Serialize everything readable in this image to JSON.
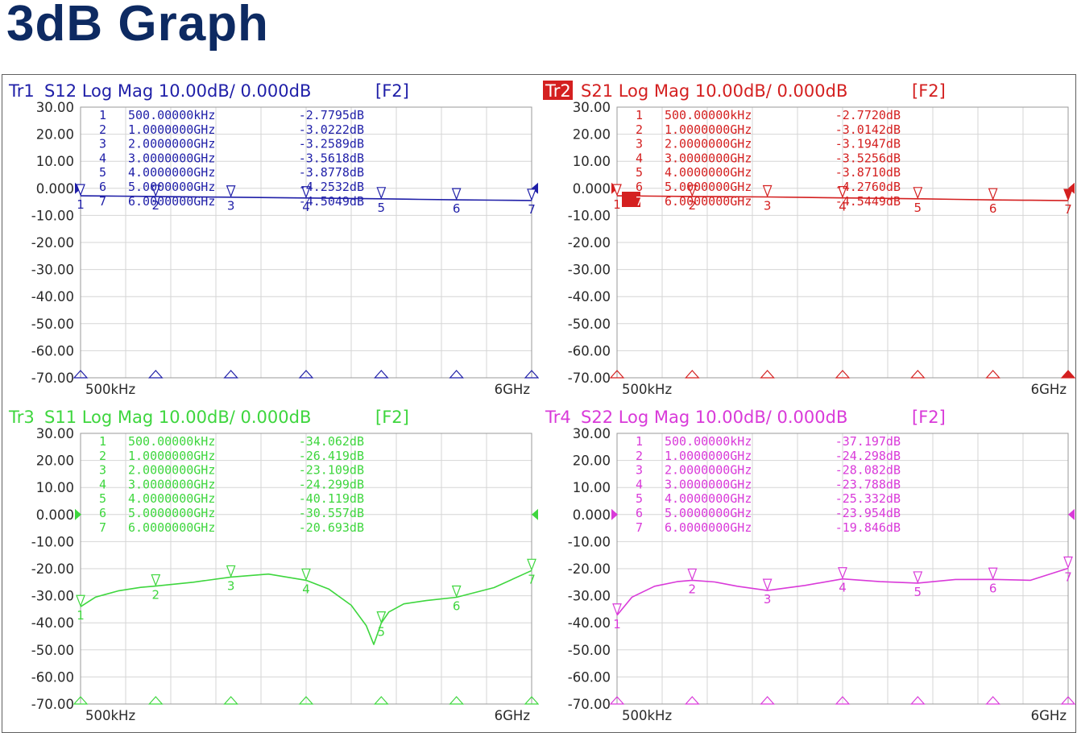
{
  "title": "3dB Graph",
  "chart_data": [
    {
      "type": "line",
      "trace_label": "Tr1",
      "header": "S12 Log Mag 10.00dB/ 0.000dB",
      "function_key": "[F2]",
      "color": "#1f1fa8",
      "active": false,
      "y_ticks": [
        "30.00",
        "20.00",
        "10.00",
        "0.000",
        "-10.00",
        "-20.00",
        "-30.00",
        "-40.00",
        "-50.00",
        "-60.00",
        "-70.00"
      ],
      "ylim": [
        -70,
        30
      ],
      "x_start_label": "500kHz",
      "x_stop_label": "6GHz",
      "xlim_ghz": [
        0.0005,
        6
      ],
      "markers": [
        {
          "num": "1",
          "freq": "500.00000kHz",
          "value": "-2.7795dB"
        },
        {
          "num": "2",
          "freq": "1.0000000GHz",
          "value": "-3.0222dB"
        },
        {
          "num": "3",
          "freq": "2.0000000GHz",
          "value": "-3.2589dB"
        },
        {
          "num": "4",
          "freq": "3.0000000GHz",
          "value": "-3.5618dB"
        },
        {
          "num": "5",
          "freq": "4.0000000GHz",
          "value": "-3.8778dB"
        },
        {
          "num": "6",
          "freq": "5.0000000GHz",
          "value": "-4.2532dB"
        },
        {
          "num": "7",
          "freq": "6.0000000GHz",
          "value": "-4.5049dB"
        }
      ],
      "trace": {
        "x": [
          0.0005,
          0.5,
          1,
          1.5,
          2,
          2.5,
          3,
          3.5,
          4,
          4.5,
          5,
          5.5,
          6
        ],
        "y": [
          -2.78,
          -2.9,
          -3.02,
          -3.14,
          -3.26,
          -3.41,
          -3.56,
          -3.72,
          -3.88,
          -4.07,
          -4.25,
          -4.38,
          -4.5
        ]
      }
    },
    {
      "type": "line",
      "trace_label": "Tr2",
      "header": "S21 Log Mag 10.00dB/ 0.000dB",
      "function_key": "[F2]",
      "color": "#d42020",
      "active": true,
      "active_marker": "7",
      "y_ticks": [
        "30.00",
        "20.00",
        "10.00",
        "0.000",
        "-10.00",
        "-20.00",
        "-30.00",
        "-40.00",
        "-50.00",
        "-60.00",
        "-70.00"
      ],
      "ylim": [
        -70,
        30
      ],
      "x_start_label": "500kHz",
      "x_stop_label": "6GHz",
      "xlim_ghz": [
        0.0005,
        6
      ],
      "markers": [
        {
          "num": "1",
          "freq": "500.00000kHz",
          "value": "-2.7720dB"
        },
        {
          "num": "2",
          "freq": "1.0000000GHz",
          "value": "-3.0142dB"
        },
        {
          "num": "3",
          "freq": "2.0000000GHz",
          "value": "-3.1947dB"
        },
        {
          "num": "4",
          "freq": "3.0000000GHz",
          "value": "-3.5256dB"
        },
        {
          "num": "5",
          "freq": "4.0000000GHz",
          "value": "-3.8710dB"
        },
        {
          "num": "6",
          "freq": "5.0000000GHz",
          "value": "-4.2760dB"
        },
        {
          "num": "7",
          "freq": "6.0000000GHz",
          "value": "-4.5449dB"
        }
      ],
      "trace": {
        "x": [
          0.0005,
          0.5,
          1,
          1.5,
          2,
          2.5,
          3,
          3.5,
          4,
          4.5,
          5,
          5.5,
          6
        ],
        "y": [
          -2.77,
          -2.89,
          -3.01,
          -3.1,
          -3.19,
          -3.36,
          -3.53,
          -3.7,
          -3.87,
          -4.07,
          -4.28,
          -4.41,
          -4.54
        ]
      }
    },
    {
      "type": "line",
      "trace_label": "Tr3",
      "header": "S11 Log Mag 10.00dB/ 0.000dB",
      "function_key": "[F2]",
      "color": "#3ed63e",
      "active": false,
      "y_ticks": [
        "30.00",
        "20.00",
        "10.00",
        "0.000",
        "-10.00",
        "-20.00",
        "-30.00",
        "-40.00",
        "-50.00",
        "-60.00",
        "-70.00"
      ],
      "ylim": [
        -70,
        30
      ],
      "x_start_label": "500kHz",
      "x_stop_label": "6GHz",
      "xlim_ghz": [
        0.0005,
        6
      ],
      "markers": [
        {
          "num": "1",
          "freq": "500.00000kHz",
          "value": "-34.062dB"
        },
        {
          "num": "2",
          "freq": "1.0000000GHz",
          "value": "-26.419dB"
        },
        {
          "num": "3",
          "freq": "2.0000000GHz",
          "value": "-23.109dB"
        },
        {
          "num": "4",
          "freq": "3.0000000GHz",
          "value": "-24.299dB"
        },
        {
          "num": "5",
          "freq": "4.0000000GHz",
          "value": "-40.119dB"
        },
        {
          "num": "6",
          "freq": "5.0000000GHz",
          "value": "-30.557dB"
        },
        {
          "num": "7",
          "freq": "6.0000000GHz",
          "value": "-20.693dB"
        }
      ],
      "trace": {
        "x": [
          0.0005,
          0.2,
          0.5,
          0.8,
          1.0,
          1.5,
          2.0,
          2.5,
          3.0,
          3.3,
          3.6,
          3.8,
          3.9,
          4.0,
          4.1,
          4.3,
          4.6,
          5.0,
          5.5,
          6.0
        ],
        "y": [
          -34.06,
          -30.5,
          -28.2,
          -26.9,
          -26.42,
          -25.0,
          -23.11,
          -22.0,
          -24.3,
          -27.5,
          -33.5,
          -41.0,
          -48.0,
          -40.12,
          -36.0,
          -33.0,
          -31.8,
          -30.56,
          -27.0,
          -20.69
        ]
      }
    },
    {
      "type": "line",
      "trace_label": "Tr4",
      "header": "S22 Log Mag 10.00dB/ 0.000dB",
      "function_key": "[F2]",
      "color": "#d93ad9",
      "active": false,
      "y_ticks": [
        "30.00",
        "20.00",
        "10.00",
        "0.000",
        "-10.00",
        "-20.00",
        "-30.00",
        "-40.00",
        "-50.00",
        "-60.00",
        "-70.00"
      ],
      "ylim": [
        -70,
        30
      ],
      "x_start_label": "500kHz",
      "x_stop_label": "6GHz",
      "xlim_ghz": [
        0.0005,
        6
      ],
      "markers": [
        {
          "num": "1",
          "freq": "500.00000kHz",
          "value": "-37.197dB"
        },
        {
          "num": "2",
          "freq": "1.0000000GHz",
          "value": "-24.298dB"
        },
        {
          "num": "3",
          "freq": "2.0000000GHz",
          "value": "-28.082dB"
        },
        {
          "num": "4",
          "freq": "3.0000000GHz",
          "value": "-23.788dB"
        },
        {
          "num": "5",
          "freq": "4.0000000GHz",
          "value": "-25.332dB"
        },
        {
          "num": "6",
          "freq": "5.0000000GHz",
          "value": "-23.954dB"
        },
        {
          "num": "7",
          "freq": "6.0000000GHz",
          "value": "-19.846dB"
        }
      ],
      "trace": {
        "x": [
          0.0005,
          0.2,
          0.5,
          0.8,
          1.0,
          1.3,
          1.6,
          2.0,
          2.5,
          3.0,
          3.5,
          4.0,
          4.5,
          5.0,
          5.5,
          6.0
        ],
        "y": [
          -37.2,
          -30.5,
          -26.5,
          -24.8,
          -24.3,
          -24.9,
          -26.5,
          -28.08,
          -26.2,
          -23.79,
          -24.8,
          -25.33,
          -24.0,
          -23.95,
          -24.3,
          -19.85
        ]
      }
    }
  ]
}
